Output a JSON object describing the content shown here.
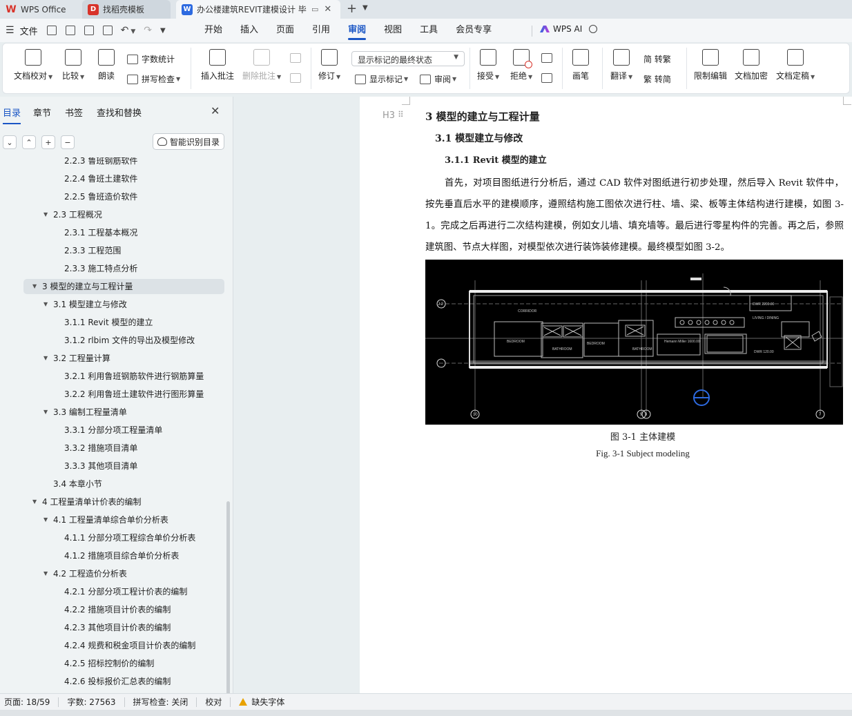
{
  "tabs": {
    "app": "WPS Office",
    "template": "找稻壳模板",
    "document": "办公楼建筑REVIT建模设计 毕"
  },
  "menubar": {
    "file": "文件",
    "items": [
      "开始",
      "插入",
      "页面",
      "引用",
      "审阅",
      "视图",
      "工具",
      "会员专享"
    ],
    "active": "审阅",
    "ai": "WPS AI"
  },
  "ribbon": {
    "proofread": "文档校对",
    "compare": "比较",
    "read_aloud": "朗读",
    "word_count": "字数统计",
    "spell_check": "拼写检查",
    "insert_comment": "插入批注",
    "delete_comment": "删除批注",
    "track_changes": "修订",
    "markup_display": "显示标记的最终状态",
    "show_markup": "显示标记",
    "review": "审阅",
    "accept": "接受",
    "reject": "拒绝",
    "ink": "画笔",
    "translate": "翻译",
    "to_traditional": "简 转繁",
    "to_simplified": "繁 转简",
    "restrict_edit": "限制编辑",
    "encrypt": "文档加密",
    "finalize": "文档定稿"
  },
  "leftpanel": {
    "tabs": [
      "目录",
      "章节",
      "书签",
      "查找和替换"
    ],
    "smart_toc": "智能识别目录",
    "toc": [
      {
        "level": 3,
        "text": "2.2.3 鲁班钢筋软件"
      },
      {
        "level": 3,
        "text": "2.2.4 鲁班土建软件"
      },
      {
        "level": 3,
        "text": "2.2.5 鲁班造价软件"
      },
      {
        "level": 2,
        "text": "2.3 工程概况",
        "expand": true
      },
      {
        "level": 3,
        "text": "2.3.1 工程基本概况"
      },
      {
        "level": 3,
        "text": "2.3.3 工程范围"
      },
      {
        "level": 3,
        "text": "2.3.3 施工特点分析"
      },
      {
        "level": 1,
        "text": "3 模型的建立与工程计量",
        "expand": true,
        "current": true
      },
      {
        "level": 2,
        "text": "3.1 模型建立与修改",
        "expand": true
      },
      {
        "level": 3,
        "text": "3.1.1 Revit  模型的建立"
      },
      {
        "level": 3,
        "text": "3.1.2 rlbim 文件的导出及模型修改"
      },
      {
        "level": 2,
        "text": "3.2 工程量计算",
        "expand": true
      },
      {
        "level": 3,
        "text": "3.2.1 利用鲁班钢筋软件进行钢筋算量"
      },
      {
        "level": 3,
        "text": "3.2.2 利用鲁班土建软件进行图形算量"
      },
      {
        "level": 2,
        "text": "3.3 编制工程量清单",
        "expand": true
      },
      {
        "level": 3,
        "text": "3.3.1 分部分项工程量清单"
      },
      {
        "level": 3,
        "text": "3.3.2 措施项目清单"
      },
      {
        "level": 3,
        "text": "3.3.3 其他项目清单"
      },
      {
        "level": 2,
        "text": "3.4 本章小节"
      },
      {
        "level": 1,
        "text": "4 工程量清单计价表的编制",
        "expand": true
      },
      {
        "level": 2,
        "text": "4.1 工程量清单综合单价分析表",
        "expand": true
      },
      {
        "level": 3,
        "text": "4.1.1 分部分项工程综合单价分析表"
      },
      {
        "level": 3,
        "text": "4.1.2 措施项目综合单价分析表"
      },
      {
        "level": 2,
        "text": "4.2 工程造价分析表",
        "expand": true
      },
      {
        "level": 3,
        "text": "4.2.1 分部分项工程计价表的编制"
      },
      {
        "level": 3,
        "text": "4.2.2 措施项目计价表的编制"
      },
      {
        "level": 3,
        "text": "4.2.3 其他项目计价表的编制"
      },
      {
        "level": 3,
        "text": "4.2.4 规费和税金项目计价表的编制"
      },
      {
        "level": 3,
        "text": "4.2.5 招标控制价的编制"
      },
      {
        "level": 3,
        "text": "4.2.6 投标报价汇总表的编制"
      }
    ]
  },
  "document": {
    "h3_tag": "H3",
    "h1": "3 模型的建立与工程计量",
    "h2": "3.1 模型建立与修改",
    "h3": "3.1.1 Revit  模型的建立",
    "paragraph": "首先，对项目图纸进行分析后，通过 CAD 软件对图纸进行初步处理，然后导入 Revit 软件中，按先垂直后水平的建模顺序，遵照结构施工图依次进行柱、墙、梁、板等主体结构进行建模，如图 3-1。完成之后再进行二次结构建模，例如女儿墙、填充墙等。最后进行零星构件的完善。再之后，参照建筑图、节点大样图，对模型依次进行装饰装修建模。最终模型如图 3-2。",
    "figure": {
      "labels": [
        "CORRIDOR",
        "BEDROOM",
        "BATHROOM",
        "BEDROOM",
        "BATHROOM",
        "DWR 2200.00",
        "Hemann Miller 1600.00",
        "DWR 120.00",
        "LIVING / DINING"
      ],
      "grid_top": [
        "J.2"
      ],
      "grid_bottom": [
        "10",
        "9",
        "8",
        "7"
      ]
    },
    "caption_cn": "图 3-1  主体建模",
    "caption_en": "Fig. 3-1 Subject modeling"
  },
  "statusbar": {
    "page": "页面: 18/59",
    "words": "字数: 27563",
    "spell": "拼写检查: 关闭",
    "proof": "校对",
    "missing_font": "缺失字体"
  }
}
